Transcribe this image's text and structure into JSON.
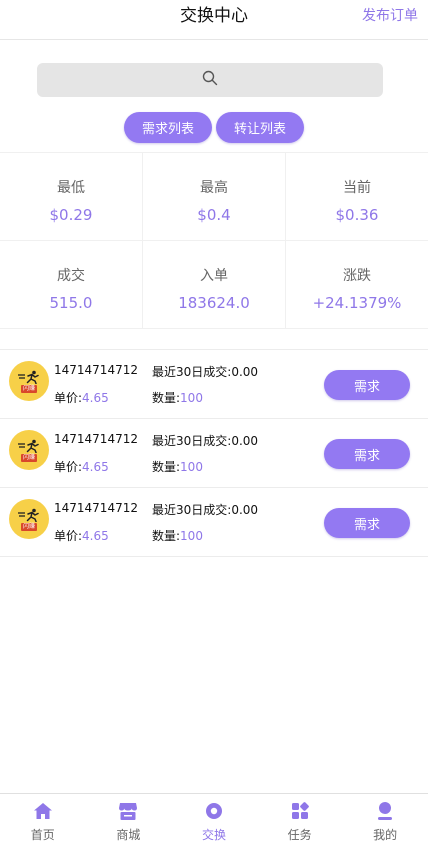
{
  "header": {
    "title": "交换中心",
    "publish_label": "发布订单"
  },
  "search": {
    "icon": "search-icon"
  },
  "toggles": {
    "demand_list": "需求列表",
    "transfer_list": "转让列表"
  },
  "stats": [
    {
      "label": "最低",
      "value": "$0.29"
    },
    {
      "label": "最高",
      "value": "$0.4"
    },
    {
      "label": "当前",
      "value": "$0.36"
    },
    {
      "label": "成交",
      "value": "515.0"
    },
    {
      "label": "入单",
      "value": "183624.0"
    },
    {
      "label": "涨跌",
      "value": "+24.1379%"
    }
  ],
  "orders": [
    {
      "phone": "14714714712",
      "recent_label": "最近30日成交:",
      "recent_value": "0.00",
      "price_label": "单价:",
      "price_value": "4.65",
      "qty_label": "数量:",
      "qty_value": "100",
      "button": "需求",
      "avatar_text": "闪赚"
    },
    {
      "phone": "14714714712",
      "recent_label": "最近30日成交:",
      "recent_value": "0.00",
      "price_label": "单价:",
      "price_value": "4.65",
      "qty_label": "数量:",
      "qty_value": "100",
      "button": "需求",
      "avatar_text": "闪赚"
    },
    {
      "phone": "14714714712",
      "recent_label": "最近30日成交:",
      "recent_value": "0.00",
      "price_label": "单价:",
      "price_value": "4.65",
      "qty_label": "数量:",
      "qty_value": "100",
      "button": "需求",
      "avatar_text": "闪赚"
    }
  ],
  "tabbar": [
    {
      "label": "首页",
      "icon": "home-icon"
    },
    {
      "label": "商城",
      "icon": "store-icon"
    },
    {
      "label": "交换",
      "icon": "exchange-icon",
      "active": true
    },
    {
      "label": "任务",
      "icon": "tasks-icon"
    },
    {
      "label": "我的",
      "icon": "profile-icon"
    }
  ],
  "colors": {
    "accent": "#8f77e8",
    "button": "#9379f2",
    "avatar_bg": "#f7d048"
  }
}
